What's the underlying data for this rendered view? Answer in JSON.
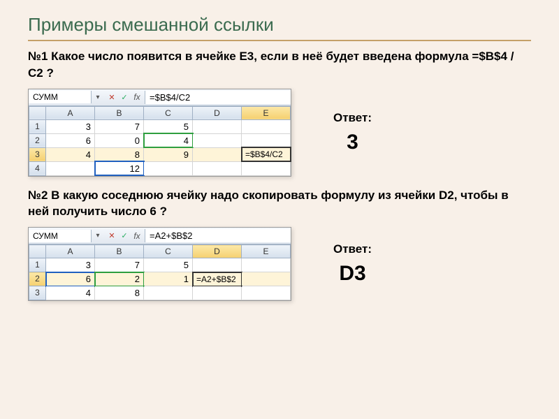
{
  "slide_title": "Примеры смешанной ссылки",
  "q1": {
    "text": "№1 Какое число появится в ячейке  E3, если в неё будет введена формула  =$B$4 / C2 ?",
    "name_box": "СУММ",
    "formula": "=$B$4/C2",
    "cols": [
      "A",
      "B",
      "C",
      "D",
      "E"
    ],
    "rows": [
      "1",
      "2",
      "3",
      "4"
    ],
    "cells": {
      "A1": "3",
      "B1": "7",
      "C1": "5",
      "D1": "",
      "E1": "",
      "A2": "6",
      "B2": "0",
      "C2": "4",
      "D2": "",
      "E2": "",
      "A3": "4",
      "B3": "8",
      "C3": "9",
      "D3": "",
      "E3": "=$B$4/C2",
      "A4": "",
      "B4": "12",
      "C4": "",
      "D4": "",
      "E4": ""
    },
    "answer_label": "Ответ:",
    "answer": "3"
  },
  "q2": {
    "text": "№2 В какую соседнюю ячейку надо скопировать формулу из ячейки D2, чтобы в ней получить число  6 ?",
    "name_box": "СУММ",
    "formula": "=A2+$B$2",
    "cols": [
      "A",
      "B",
      "C",
      "D",
      "E"
    ],
    "rows": [
      "1",
      "2",
      "3"
    ],
    "cells": {
      "A1": "3",
      "B1": "7",
      "C1": "5",
      "D1": "",
      "E1": "",
      "A2": "6",
      "B2": "2",
      "C2": "1",
      "D2": "=A2+$B$2",
      "E2": "",
      "A3": "4",
      "B3": "8",
      "C3": "",
      "D3": "",
      "E3": ""
    },
    "answer_label": "Ответ:",
    "answer": "D3"
  }
}
